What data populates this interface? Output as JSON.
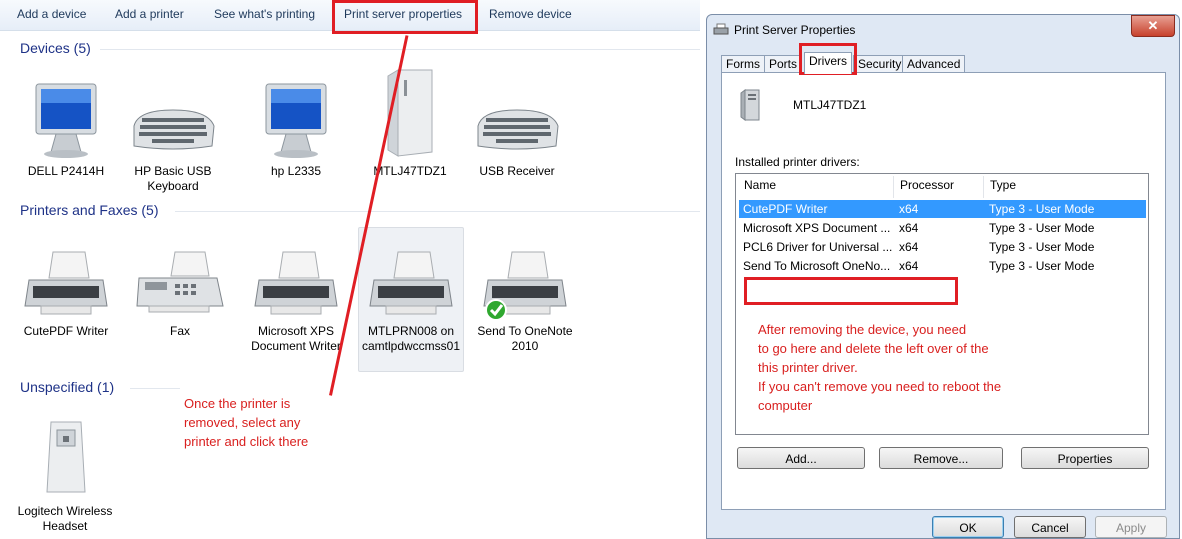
{
  "toolbar": {
    "items": [
      "Add a device",
      "Add a printer",
      "See what's printing",
      "Print server properties",
      "Remove device"
    ]
  },
  "sections": {
    "devices": "Devices (5)",
    "printers": "Printers and Faxes (5)",
    "unspecified": "Unspecified (1)"
  },
  "devices": [
    {
      "label": "DELL P2414H",
      "icon": "monitor-icon"
    },
    {
      "label": "HP Basic USB Keyboard",
      "icon": "keyboard-icon"
    },
    {
      "label": "hp L2335",
      "icon": "monitor-icon"
    },
    {
      "label": "MTLJ47TDZ1",
      "icon": "computer-tower-icon"
    },
    {
      "label": "USB Receiver",
      "icon": "keyboard-icon"
    }
  ],
  "printers": [
    {
      "label": "CutePDF Writer",
      "icon": "printer-icon"
    },
    {
      "label": "Fax",
      "icon": "fax-icon"
    },
    {
      "label": "Microsoft XPS Document Writer",
      "icon": "printer-icon"
    },
    {
      "label": "MTLPRN008 on camtlpdwccmss01",
      "icon": "printer-icon"
    },
    {
      "label": "Send To OneNote 2010",
      "icon": "printer-default-icon"
    }
  ],
  "unspecified": [
    {
      "label": "Logitech Wireless Headset",
      "icon": "headset-receiver-icon"
    }
  ],
  "annotations": {
    "left": [
      "Once the printer is",
      "removed, select any",
      "printer and click there"
    ],
    "right": [
      "After removing the device, you need",
      "to go here and delete the left over of the",
      "this printer driver.",
      "If you can't remove you need to reboot the",
      "computer"
    ]
  },
  "dialog": {
    "title": "Print Server Properties",
    "close_label": "✕",
    "tabs": [
      "Forms",
      "Ports",
      "Drivers",
      "Security",
      "Advanced"
    ],
    "server_name": "MTLJ47TDZ1",
    "installed_label": "Installed printer drivers:",
    "columns": [
      "Name",
      "Processor",
      "Type"
    ],
    "drivers": [
      {
        "name": "CutePDF Writer",
        "processor": "x64",
        "type": "Type 3 - User Mode"
      },
      {
        "name": "Microsoft XPS Document ...",
        "processor": "x64",
        "type": "Type 3 - User Mode"
      },
      {
        "name": "PCL6 Driver for Universal ...",
        "processor": "x64",
        "type": "Type 3 - User Mode"
      },
      {
        "name": "Send To Microsoft OneNo...",
        "processor": "x64",
        "type": "Type 3 - User Mode"
      }
    ],
    "buttons": {
      "add": "Add...",
      "remove": "Remove...",
      "properties": "Properties"
    },
    "footer": {
      "ok": "OK",
      "cancel": "Cancel",
      "apply": "Apply"
    }
  },
  "colors": {
    "annotation": "#d9201f",
    "accent": "#3399ff",
    "section": "#1e3287"
  }
}
